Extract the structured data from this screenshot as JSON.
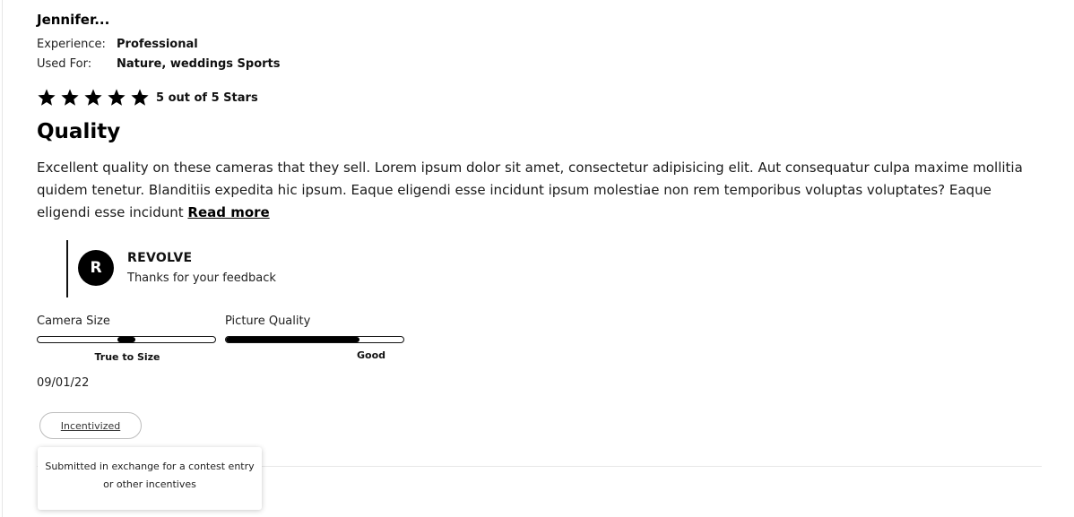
{
  "review": {
    "author": "Jennifer...",
    "experience_label": "Experience:",
    "experience_value": "Professional",
    "used_for_label": "Used For:",
    "used_for_value": "Nature, weddings Sports",
    "rating": {
      "value": 5,
      "max": 5,
      "text": "5 out of 5 Stars"
    },
    "title": "Quality",
    "body": "Excellent quality on these cameras that they sell. Lorem ipsum dolor sit amet, consectetur adipisicing elit. Aut consequatur culpa maxime mollitia quidem tenetur. Blanditiis expedita hic ipsum. Eaque eligendi esse incidunt ipsum molestiae non rem temporibus voluptas voluptates?  Eaque eligendi esse incidunt",
    "read_more": "Read more",
    "date": "09/01/22",
    "badge": "Incentivized",
    "tooltip": "Submitted in exchange for a contest entry or other incentives"
  },
  "reply": {
    "avatar_letter": "R",
    "name": "REVOLVE",
    "text": "Thanks for your feedback"
  },
  "fit": {
    "camera_size": {
      "label": "Camera Size",
      "caption": "True to Size",
      "position": 0.5
    },
    "picture_quality": {
      "label": "Picture Quality",
      "caption": "Good",
      "fill": 0.75
    }
  },
  "icons": {
    "star": "star-icon"
  },
  "colors": {
    "text": "#111111",
    "accent": "#000000",
    "divider": "#e8e8e8"
  }
}
